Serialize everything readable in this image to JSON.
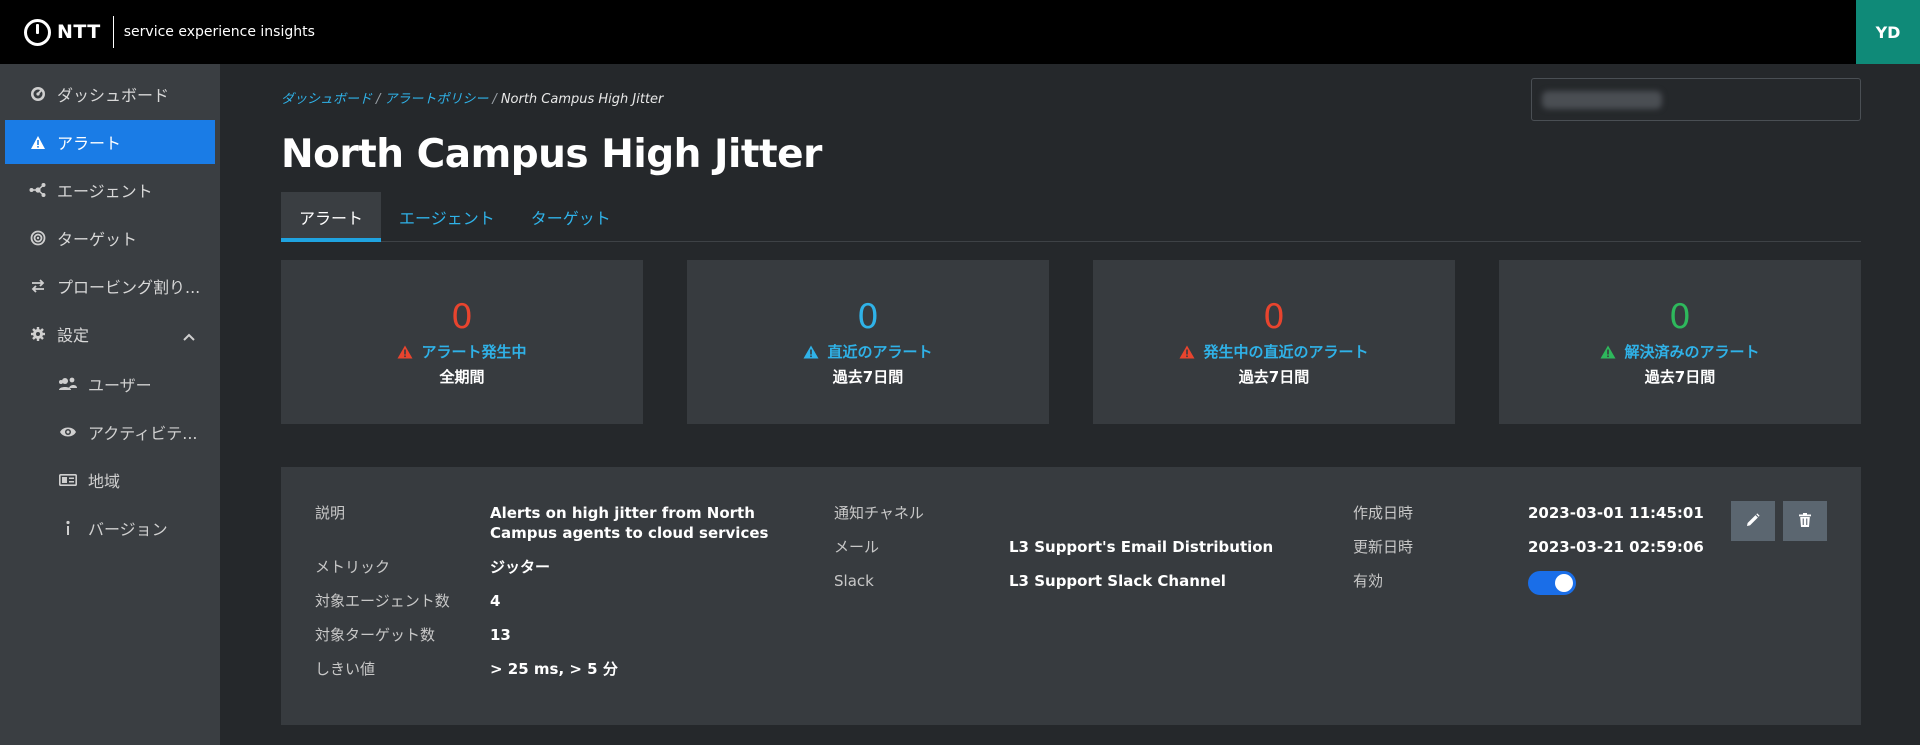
{
  "header": {
    "brand": "NTT",
    "product": "service experience insights",
    "user_initials": "YD"
  },
  "sidebar": {
    "items": [
      {
        "label": "ダッシュボード",
        "icon": "dashboard-icon"
      },
      {
        "label": "アラート",
        "icon": "warning-icon",
        "active": true
      },
      {
        "label": "エージェント",
        "icon": "agents-icon"
      },
      {
        "label": "ターゲット",
        "icon": "target-icon"
      },
      {
        "label": "プロービング割り...",
        "icon": "swap-icon"
      },
      {
        "label": "設定",
        "icon": "gear-icon",
        "expanded": true
      }
    ],
    "settings_items": [
      {
        "label": "ユーザー",
        "icon": "users-icon"
      },
      {
        "label": "アクティビテ...",
        "icon": "eye-icon"
      },
      {
        "label": "地域",
        "icon": "id-card-icon"
      },
      {
        "label": "バージョン",
        "icon": "info-icon"
      }
    ]
  },
  "breadcrumb": {
    "items": [
      "ダッシュボード",
      "アラートポリシー"
    ],
    "separator": "/",
    "current": "North Campus High Jitter"
  },
  "page": {
    "title": "North Campus High Jitter"
  },
  "tabs": [
    {
      "label": "アラート",
      "active": true
    },
    {
      "label": "エージェント"
    },
    {
      "label": "ターゲット"
    }
  ],
  "stats": [
    {
      "value": "0",
      "label": "アラート発生中",
      "period": "全期間",
      "value_color": "#e8442e",
      "label_color": "#2fb2e8",
      "icon_color": "#e8442e"
    },
    {
      "value": "0",
      "label": "直近のアラート",
      "period": "過去7日間",
      "value_color": "#2fb2e8",
      "label_color": "#2fb2e8",
      "icon_color": "#2fb2e8"
    },
    {
      "value": "0",
      "label": "発生中の直近のアラート",
      "period": "過去7日間",
      "value_color": "#e8442e",
      "label_color": "#2fb2e8",
      "icon_color": "#e8442e"
    },
    {
      "value": "0",
      "label": "解決済みのアラート",
      "period": "過去7日間",
      "value_color": "#2eb85c",
      "label_color": "#2fb2e8",
      "icon_color": "#2eb85c"
    }
  ],
  "details": {
    "description_label": "説明",
    "description_value": "Alerts on high jitter from North Campus agents to cloud services",
    "metric_label": "メトリック",
    "metric_value": "ジッター",
    "agents_label": "対象エージェント数",
    "agents_value": "4",
    "targets_label": "対象ターゲット数",
    "targets_value": "13",
    "threshold_label": "しきい値",
    "threshold_value": "> 25 ms, > 5 分",
    "channel_label": "通知チャネル",
    "mail_label": "メール",
    "mail_value": "L3 Support's Email Distribution",
    "slack_label": "Slack",
    "slack_value": "L3 Support Slack Channel",
    "created_label": "作成日時",
    "created_value": "2023-03-01 11:45:01",
    "updated_label": "更新日時",
    "updated_value": "2023-03-21 02:59:06",
    "enabled_label": "有効",
    "enabled": true
  },
  "actions": {
    "edit_icon": "pencil-icon",
    "delete_icon": "trash-icon"
  }
}
